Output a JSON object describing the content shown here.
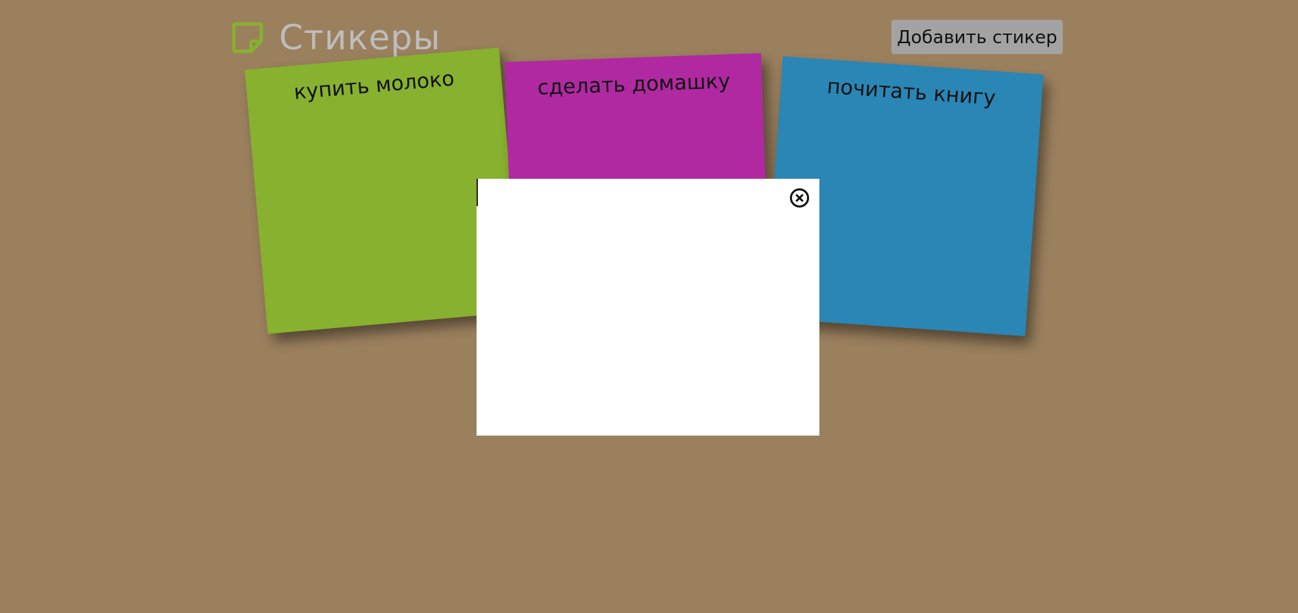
{
  "header": {
    "title": "Стикеры",
    "logo_icon": "sticky-note-icon",
    "logo_color": "#87b12f",
    "add_button_label": "Добавить стикер"
  },
  "stickers": [
    {
      "text": "купить молоко",
      "color": "#87b12f"
    },
    {
      "text": "сделать домашку",
      "color": "#b029a1"
    },
    {
      "text": "почитать книгу",
      "color": "#2a86b4"
    }
  ],
  "modal": {
    "input_value": "",
    "close_icon": "close-icon"
  },
  "colors": {
    "background": "#9b805e",
    "button_background": "#a3a3a3",
    "title_color": "#bdbdbd"
  }
}
